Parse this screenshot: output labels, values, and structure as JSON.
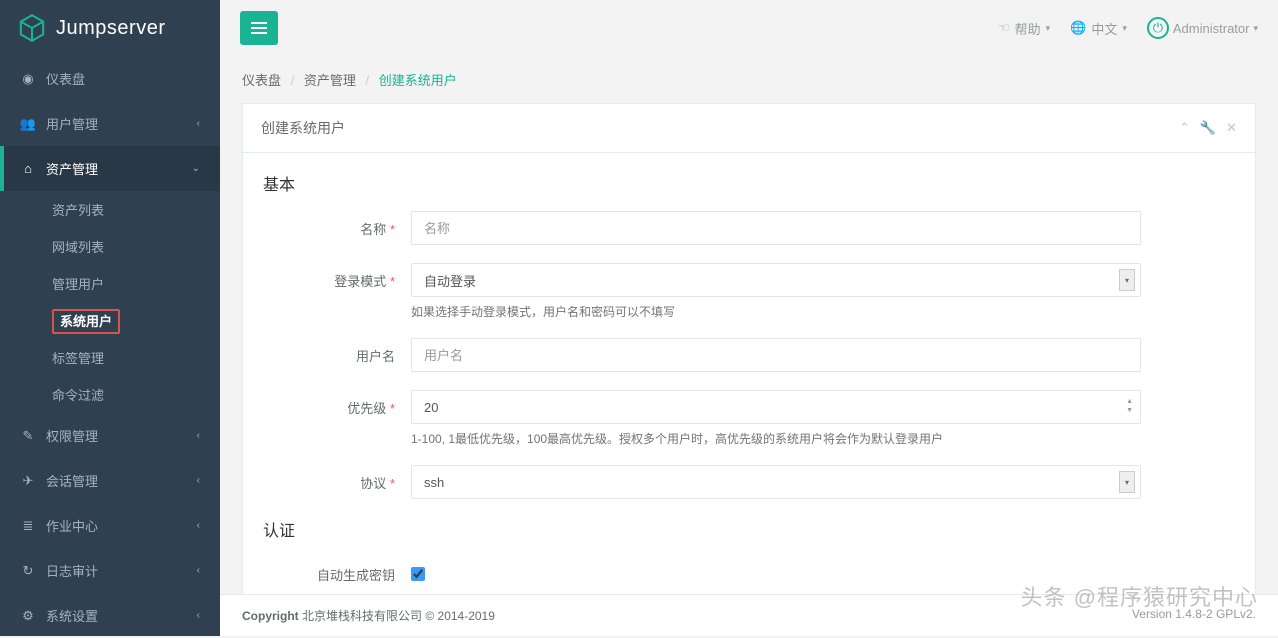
{
  "brand": "Jumpserver",
  "topbar": {
    "help": "帮助",
    "lang": "中文",
    "admin": "Administrator"
  },
  "sidebar": {
    "dashboard": "仪表盘",
    "users": "用户管理",
    "assets": "资产管理",
    "assets_sub": {
      "asset_list": "资产列表",
      "domain_list": "网域列表",
      "admin_user": "管理用户",
      "system_user": "系统用户",
      "label": "标签管理",
      "cmd_filter": "命令过滤"
    },
    "perms": "权限管理",
    "sessions": "会话管理",
    "jobs": "作业中心",
    "audit": "日志审计",
    "settings": "系统设置"
  },
  "breadcrumb": {
    "a": "仪表盘",
    "b": "资产管理",
    "c": "创建系统用户"
  },
  "panel": {
    "title": "创建系统用户"
  },
  "form": {
    "section_basic": "基本",
    "section_auth": "认证",
    "name_label": "名称",
    "name_ph": "名称",
    "login_mode_label": "登录模式",
    "login_mode_value": "自动登录",
    "login_mode_help": "如果选择手动登录模式，用户名和密码可以不填写",
    "username_label": "用户名",
    "username_ph": "用户名",
    "priority_label": "优先级",
    "priority_value": "20",
    "priority_help": "1-100, 1最低优先级，100最高优先级。授权多个用户时，高优先级的系统用户将会作为默认登录用户",
    "protocol_label": "协议",
    "protocol_value": "ssh",
    "autokey_label": "自动生成密钥"
  },
  "footer": {
    "copyright_bold": "Copyright",
    "copyright_rest": " 北京堆栈科技有限公司 © 2014-2019",
    "version": "Version 1.4.8-2 GPLv2."
  },
  "watermark": "头条 @程序猿研究中心"
}
